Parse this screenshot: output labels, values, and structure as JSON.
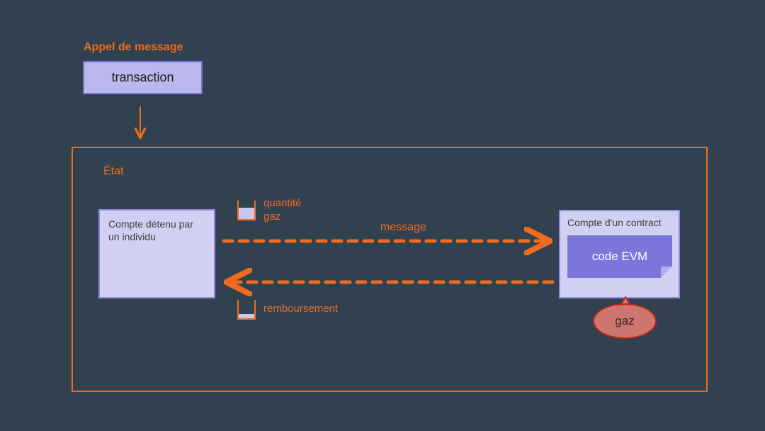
{
  "title": "Appel de message",
  "transaction_label": "transaction",
  "state_label": "État",
  "eoa_text": "Compte détenu\npar un individu",
  "contract": {
    "title": "Compte\nd'un contract",
    "evm_label": "code EVM"
  },
  "gas_qty_label": "quantité\ngaz",
  "message_label": "message",
  "refund_label": "remboursement",
  "gaz_label": "gaz",
  "colors": {
    "orange": "#ef6c1f",
    "lavender_fill": "#d1d0f2",
    "lavender_border": "#908bdd",
    "tx_fill": "#bab8ec",
    "tx_border": "#7873d8",
    "evm_fill": "#7b77da",
    "gaz_fill": "#cf756f",
    "gaz_border": "#bb261c",
    "bg": "#32414f"
  }
}
